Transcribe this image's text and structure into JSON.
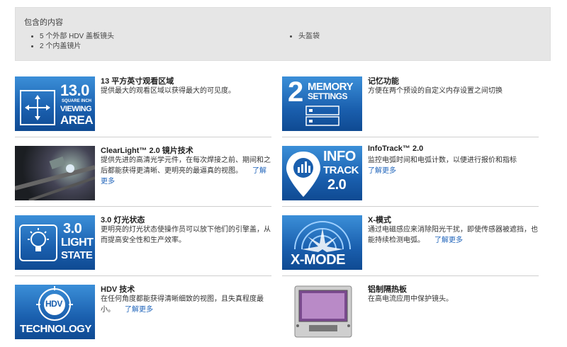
{
  "contents": {
    "title": "包含的内容",
    "left_items": [
      "5 个外部 HDV 盖板镜头",
      "2 个内盖镜片"
    ],
    "right_items": [
      "头盔袋"
    ]
  },
  "features": [
    {
      "id": "viewing-area",
      "title": "13 平方英寸观看区域",
      "desc": "提供最大的观看区域以获得最大的可见度。",
      "icon": {
        "line1": "13.0",
        "line2": "SQUARE INCH",
        "line3": "VIEWING",
        "line4": "AREA"
      }
    },
    {
      "id": "memory",
      "title": "记忆功能",
      "desc": "方便在两个预设的自定义内存设置之间切换",
      "icon": {
        "num": "2",
        "line1": "MEMORY",
        "line2": "SETTINGS"
      }
    },
    {
      "id": "clearlight",
      "title": "ClearLight™ 2.0 镜片技术",
      "desc": "提供先进的高清光学元件，在每次焊接之前、期间和之后都能获得更清晰、更明亮的最逼真的视图。",
      "learn_more": "了解更多"
    },
    {
      "id": "infotrack",
      "title": "InfoTrack™ 2.0",
      "desc": "监控电弧时间和电弧计数，以便进行报价和指标",
      "learn_more": "了解更多",
      "icon": {
        "line1": "INFO",
        "line2": "TRACK",
        "line3": "2.0"
      }
    },
    {
      "id": "light-state",
      "title": "3.0 灯光状态",
      "desc": "更明亮的灯光状态使操作员可以放下他们的引擎盖，从而提高安全性和生产效率。",
      "icon": {
        "line1": "3.0",
        "line2": "LIGHT",
        "line3": "STATE"
      }
    },
    {
      "id": "xmode",
      "title": "X-模式",
      "desc": "通过电磁感应来消除阳光干扰，即使传感器被遮挡，也能持续检测电弧。",
      "learn_more": "了解更多",
      "icon": {
        "line1": "X-MODE"
      }
    },
    {
      "id": "hdv",
      "title": "HDV 技术",
      "desc": "在任何角度都能获得清晰细致的视图，且失真程度最小。",
      "learn_more": "了解更多",
      "icon": {
        "badge": "HDV",
        "line1": "TECHNOLOGY"
      }
    },
    {
      "id": "heatshield",
      "title": "铝制隔热板",
      "desc": "在高电流应用中保护镜头。"
    }
  ],
  "colors": {
    "icon_blue_top": "#3b8fd8",
    "icon_blue_bottom": "#0f4a92",
    "link": "#2266bb",
    "divider": "#cfcfcf",
    "box_bg": "#e6e6e6"
  }
}
